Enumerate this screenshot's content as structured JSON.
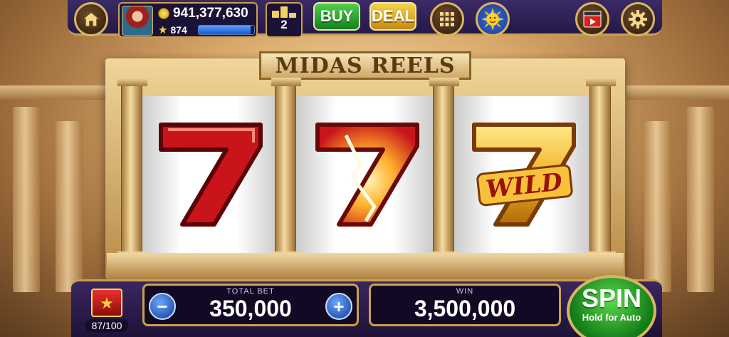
{
  "top_bar": {
    "coins": "941,377,630",
    "level": "874",
    "xp_progress": 0.93,
    "podium_count": "2",
    "buy_label": "BUY",
    "deal_label": "DEAL"
  },
  "machine": {
    "title": "MIDAS REELS",
    "reels": [
      {
        "symbol": "red-seven"
      },
      {
        "symbol": "red-seven-wild-burst"
      },
      {
        "symbol": "gold-seven-wild",
        "wild_label": "WILD"
      }
    ]
  },
  "bottom_bar": {
    "gift_count": "87/100",
    "total_bet_label": "TOTAL BET",
    "total_bet_value": "350,000",
    "minus_label": "−",
    "plus_label": "+",
    "win_label": "WIN",
    "win_value": "3,500,000",
    "spin_label": "SPIN",
    "spin_sub_label": "Hold for Auto"
  },
  "colors": {
    "frame_gold": "#d8b463",
    "bar_purple": "#2c1d52",
    "spin_green": "#2aa82a",
    "buy_green": "#2fa82f",
    "deal_gold": "#e3ae22"
  }
}
